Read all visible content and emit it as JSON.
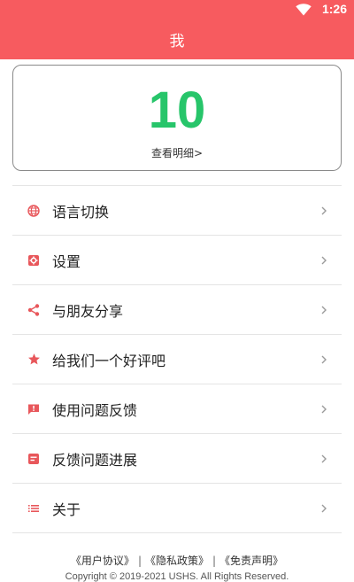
{
  "status_bar": {
    "time": "1:26",
    "icons": [
      "wifi-icon"
    ]
  },
  "app_bar": {
    "title": "我"
  },
  "points_card": {
    "value": "10",
    "detail_link": "查看明细>",
    "value_color": "#27c56a"
  },
  "menu": {
    "items": [
      {
        "label": "语言切换",
        "icon": "globe-icon"
      },
      {
        "label": "设置",
        "icon": "settings-icon"
      },
      {
        "label": "与朋友分享",
        "icon": "share-icon"
      },
      {
        "label": "给我们一个好评吧",
        "icon": "star-icon"
      },
      {
        "label": "使用问题反馈",
        "icon": "feedback-icon"
      },
      {
        "label": "反馈问题进展",
        "icon": "progress-icon"
      },
      {
        "label": "关于",
        "icon": "list-icon"
      }
    ]
  },
  "footer": {
    "user_agreement": "《用户协议》",
    "privacy_policy": "《隐私政策》",
    "disclaimer": "《免责声明》",
    "separator": "|",
    "copyright": "Copyright © 2019-2021 USHS. All Rights Reserved."
  },
  "colors": {
    "accent": "#f75b5f",
    "icon": "#e8575b",
    "divider": "#e4e4e4"
  }
}
